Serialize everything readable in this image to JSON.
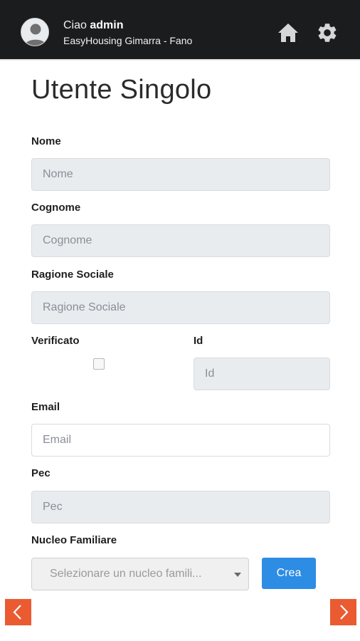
{
  "header": {
    "greeting_prefix": "Ciao",
    "username": "admin",
    "subtitle": "EasyHousing Gimarra - Fano",
    "icons": [
      "avatar",
      "home-icon",
      "gear-icon"
    ]
  },
  "page": {
    "title": "Utente Singolo"
  },
  "form": {
    "nome": {
      "label": "Nome",
      "placeholder": "Nome",
      "value": ""
    },
    "cognome": {
      "label": "Cognome",
      "placeholder": "Cognome",
      "value": ""
    },
    "ragione_sociale": {
      "label": "Ragione Sociale",
      "placeholder": "Ragione Sociale",
      "value": ""
    },
    "verificato": {
      "label": "Verificato",
      "checked": false
    },
    "id": {
      "label": "Id",
      "placeholder": "Id",
      "value": ""
    },
    "email": {
      "label": "Email",
      "placeholder": "Email",
      "value": ""
    },
    "pec": {
      "label": "Pec",
      "placeholder": "Pec",
      "value": ""
    },
    "nucleo_familiare": {
      "label": "Nucleo Familiare",
      "selected": "Selezionare un nucleo famili..."
    },
    "crea_label": "Crea"
  },
  "navigation": {
    "prev_icon": "chevron-left-icon",
    "next_icon": "chevron-right-icon"
  },
  "colors": {
    "header_bg": "#1b1c1e",
    "accent_button": "#2d8ce3",
    "nav_button": "#ea5b32",
    "readonly_input_bg": "#e9ecef"
  }
}
